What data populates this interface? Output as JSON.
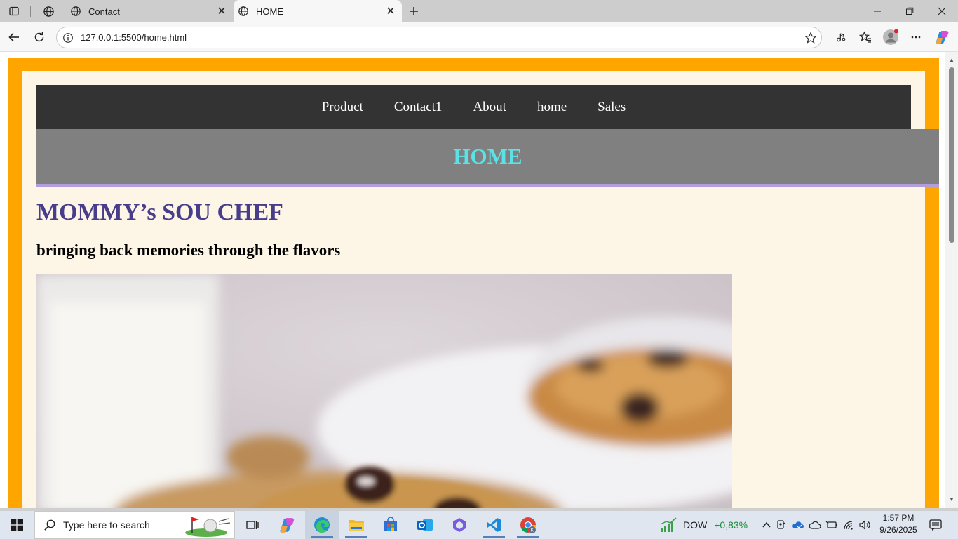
{
  "browser": {
    "tabs": [
      {
        "label": "Contact",
        "active": false
      },
      {
        "label": "HOME",
        "active": true
      }
    ],
    "url": "127.0.0.1:5500/home.html"
  },
  "page": {
    "nav": [
      "Product",
      "Contact1",
      "About",
      "home",
      "Sales"
    ],
    "banner_title": "HOME",
    "brand": "MOMMY’s SOU CHEF",
    "tagline": "bringing back memories through the flavors",
    "colors": {
      "border": "#ffa500",
      "background": "#fdf5e6",
      "nav_bg": "#333333",
      "banner_bg": "#808080",
      "banner_text": "#5ce1e6",
      "brand_text": "#483d8b"
    }
  },
  "taskbar": {
    "search_placeholder": "Type here to search",
    "stock_label": "DOW",
    "stock_change": "+0,83%",
    "time": "1:57 PM",
    "date": "9/26/2025"
  }
}
